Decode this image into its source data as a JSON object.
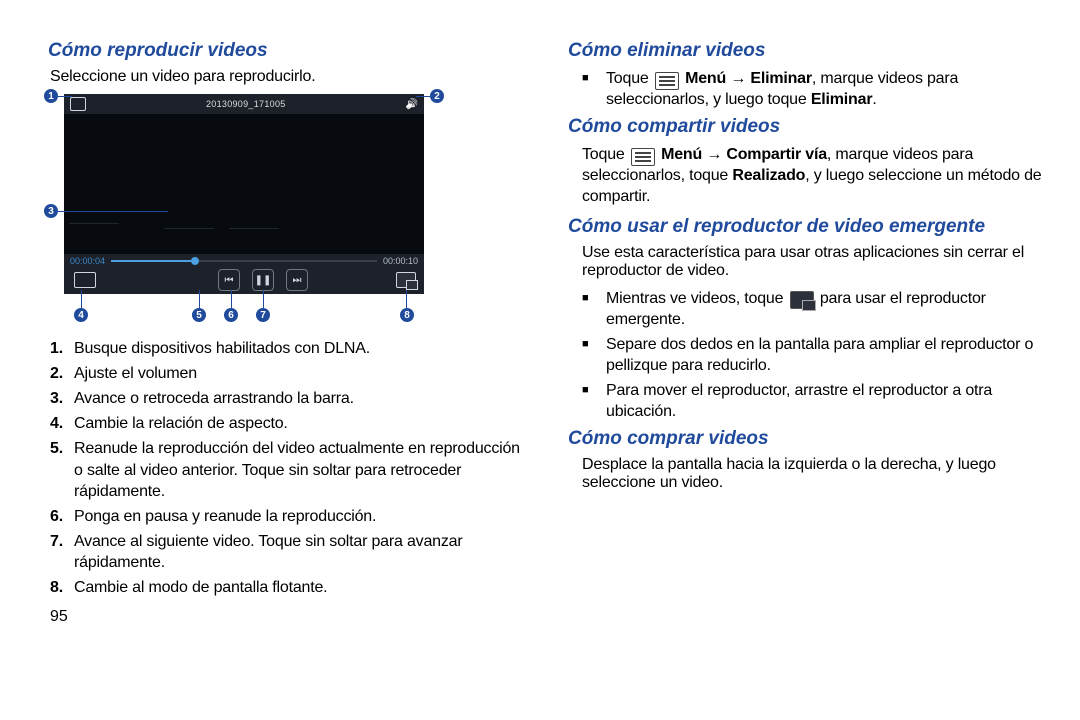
{
  "left": {
    "section_play": "Cómo reproducir videos",
    "intro_play": "Seleccione un video para reproducirlo.",
    "steps": [
      "Busque dispositivos habilitados con DLNA.",
      "Ajuste el volumen",
      "Avance o retroceda arrastrando la barra.",
      "Cambie la relación de aspecto.",
      "Reanude la reproducción del video actualmente en reproducción o salte al video anterior. Toque sin soltar para retroceder rápidamente.",
      "Ponga en pausa y reanude la reproducción.",
      "Avance al siguiente video. Toque sin soltar para avanzar rápidamente.",
      "Cambie al modo de pantalla flotante."
    ],
    "page_number": "95"
  },
  "player": {
    "filename": "20130909_171005",
    "elapsed": "00:00:04",
    "total": "00:00:10",
    "callouts": [
      "1",
      "2",
      "3",
      "4",
      "5",
      "6",
      "7",
      "8"
    ]
  },
  "right": {
    "section_delete": "Cómo eliminar videos",
    "delete_pre": "Toque ",
    "delete_mid": " Menú → Eliminar",
    "delete_post": ", marque videos para seleccionarlos, y luego toque ",
    "delete_bold2": "Eliminar",
    "delete_end": ".",
    "section_share": "Cómo compartir videos",
    "share_pre": "Toque ",
    "share_mid": " Menú → Compartir vía",
    "share_post1": ", marque videos para seleccionarlos, toque ",
    "share_bold2": "Realizado",
    "share_post2": ", y luego seleccione un método de compartir.",
    "section_popup": "Cómo usar el reproductor de video emergente",
    "popup_intro": "Use esta característica para usar otras aplicaciones sin cerrar el reproductor de video.",
    "popup_b1_pre": "Mientras ve videos, toque ",
    "popup_b1_post": " para usar el reproductor emergente.",
    "popup_b2": "Separe dos dedos en la pantalla para ampliar el reproductor o pellizque para reducirlo.",
    "popup_b3": "Para mover el reproductor, arrastre el reproductor a otra ubicación.",
    "section_buy": "Cómo comprar videos",
    "buy_text": "Desplace la pantalla hacia la izquierda o la derecha, y luego seleccione un video."
  }
}
